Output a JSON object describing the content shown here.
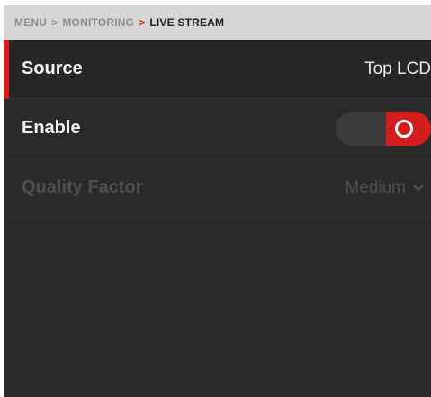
{
  "breadcrumb": {
    "items": [
      "MENU",
      "MONITORING",
      "LIVE STREAM"
    ],
    "separator": ">"
  },
  "rows": [
    {
      "label": "Source",
      "value": "Top LCD",
      "selected": true,
      "enabled": true
    },
    {
      "label": "Enable",
      "toggle_on": true,
      "enabled": true
    },
    {
      "label": "Quality Factor",
      "value": "Medium",
      "enabled": false
    }
  ],
  "colors": {
    "accent": "#d41e1e",
    "background": "#2a2a2a",
    "breadcrumb_bg": "#d6d6d6"
  },
  "icons": [
    "toggle-switch",
    "chevron-down-icon"
  ]
}
